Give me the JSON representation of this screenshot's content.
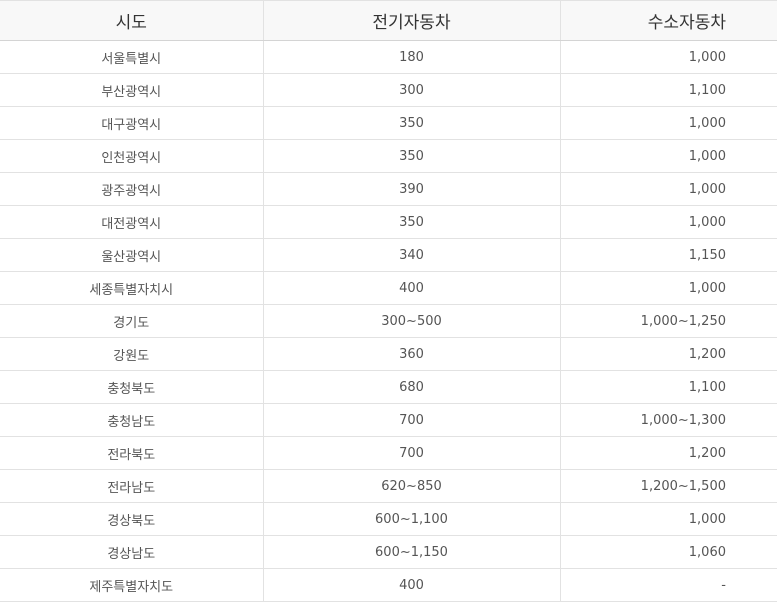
{
  "table": {
    "headers": [
      "시도",
      "전기자동차",
      "수소자동차"
    ],
    "rows": [
      [
        "서울특별시",
        "180",
        "1,000"
      ],
      [
        "부산광역시",
        "300",
        "1,100"
      ],
      [
        "대구광역시",
        "350",
        "1,000"
      ],
      [
        "인천광역시",
        "350",
        "1,000"
      ],
      [
        "광주광역시",
        "390",
        "1,000"
      ],
      [
        "대전광역시",
        "350",
        "1,000"
      ],
      [
        "울산광역시",
        "340",
        "1,150"
      ],
      [
        "세종특별자치시",
        "400",
        "1,000"
      ],
      [
        "경기도",
        "300~500",
        "1,000~1,250"
      ],
      [
        "강원도",
        "360",
        "1,200"
      ],
      [
        "충청북도",
        "680",
        "1,100"
      ],
      [
        "충청남도",
        "700",
        "1,000~1,300"
      ],
      [
        "전라북도",
        "700",
        "1,200"
      ],
      [
        "전라남도",
        "620~850",
        "1,200~1,500"
      ],
      [
        "경상북도",
        "600~1,100",
        "1,000"
      ],
      [
        "경상남도",
        "600~1,150",
        "1,060"
      ],
      [
        "제주특별자치도",
        "400",
        "-"
      ]
    ]
  }
}
